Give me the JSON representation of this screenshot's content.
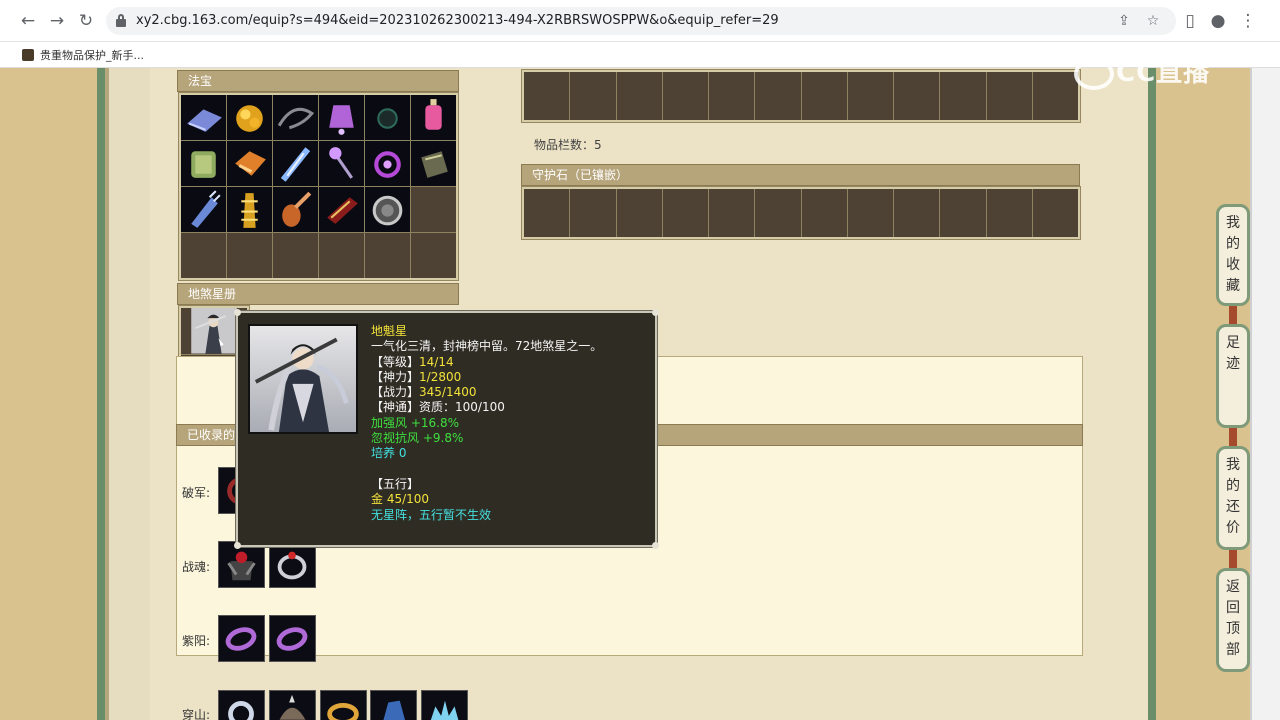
{
  "browser": {
    "url": "xy2.cbg.163.com/equip?s=494&eid=202310262300213-494-X2RBRSWOSPPW&o&equip_refer=29",
    "bookmark": "贵重物品保护_新手...",
    "icons": [
      "back-arrow-icon",
      "forward-arrow-icon",
      "reload-icon",
      "lock-icon",
      "share-icon",
      "star-icon",
      "sidebar-icon",
      "profile-icon",
      "menu-icon"
    ]
  },
  "watermark": "CC直播",
  "fabao": {
    "title": "法宝",
    "items": [
      "book-treasure",
      "gold-flower-treasure",
      "whip-treasure",
      "lantern-purple-treasure",
      "dark-orb-treasure",
      "pink-lantern-treasure",
      "jade-treasure",
      "red-gold-box-treasure",
      "ice-sword-treasure",
      "purple-staff-treasure",
      "purple-ring-treasure",
      "green-book-treasure",
      "ice-claw-treasure",
      "golden-tower-treasure",
      "pipa-treasure",
      "red-seal-treasure",
      "mirror-treasure",
      "",
      "",
      "",
      "",
      "",
      "",
      ""
    ]
  },
  "top_grid": {
    "slots": 12
  },
  "item_count": {
    "label": "物品栏数：",
    "value": "5"
  },
  "guard_stone": {
    "title": "守护石（已镶嵌）",
    "slots": 12
  },
  "disha": {
    "title": "地煞星册"
  },
  "collected": {
    "title": "已收录的",
    "rows": [
      {
        "label": "破军:",
        "count": 1
      },
      {
        "label": "战魂:",
        "count": 2
      },
      {
        "label": "紫阳:",
        "count": 2
      },
      {
        "label": "穿山:",
        "count": 5
      }
    ]
  },
  "tooltip": {
    "name": "地魁星",
    "desc": "一气化三清，封神榜中留。72地煞星之一。",
    "level_label": "【等级】",
    "level": "14/14",
    "shenli_label": "【神力】",
    "shenli": "1/2800",
    "zhanli_label": "【战力】",
    "zhanli": "345/1400",
    "shentong_label": "【神通】",
    "shentong": "资质：100/100",
    "bonus1": "加强风 +16.8%",
    "bonus2": "忽视抗风 +9.8%",
    "peiyang": "培养 0",
    "wuxing_label": "【五行】",
    "wuxing_value": "金 45/100",
    "wuxing_note": "无星阵，五行暂不生效"
  },
  "right_tabs": [
    "我的收藏",
    "足迹",
    "我的还价",
    "返回顶部"
  ],
  "colors": {
    "panel_header": "#b6a47b",
    "slot_bg": "#4d4234",
    "tooltip_bg": "#2f2c24",
    "yellow": "#f2e23a",
    "green": "#3ee03e",
    "cyan": "#43e0e0"
  }
}
